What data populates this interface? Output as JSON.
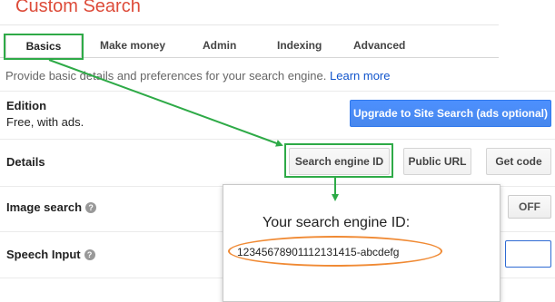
{
  "page": {
    "title": "Custom Search"
  },
  "tabs": [
    {
      "label": "Basics"
    },
    {
      "label": "Make money"
    },
    {
      "label": "Admin"
    },
    {
      "label": "Indexing"
    },
    {
      "label": "Advanced"
    }
  ],
  "intro": {
    "text": "Provide basic details and preferences for your search engine.",
    "link": "Learn more"
  },
  "edition": {
    "label": "Edition",
    "value": "Free, with ads.",
    "upgrade_button": "Upgrade to Site Search (ads optional)"
  },
  "details": {
    "label": "Details",
    "search_engine_id_button": "Search engine ID",
    "public_url_button": "Public URL",
    "get_code_button": "Get code"
  },
  "image_search": {
    "label": "Image search",
    "toggle_label": "OFF"
  },
  "speech_input": {
    "label": "Speech Input"
  },
  "popup": {
    "heading": "Your search engine ID:",
    "id_value": "12345678901112131415-abcdefg"
  },
  "colors": {
    "title_red": "#dd4b39",
    "link_blue": "#1155cc",
    "primary_blue": "#4d90fe",
    "annotation_green": "#2eaa47",
    "annotation_orange": "#f08a34"
  },
  "icons": {
    "help": "help-circle-icon",
    "help_glyph": "?"
  }
}
